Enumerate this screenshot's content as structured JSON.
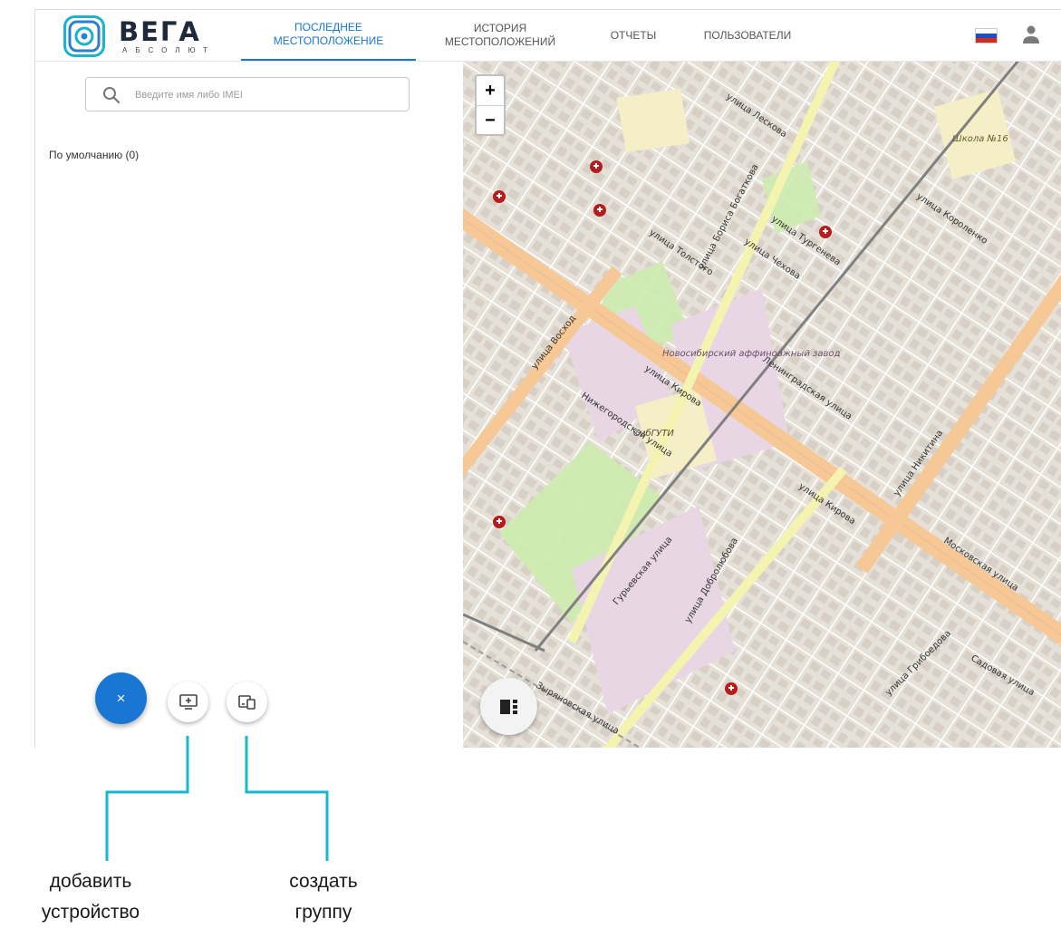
{
  "header": {
    "logo_name": "ВЕГА",
    "logo_sub": "АБСОЛЮТ",
    "tabs": [
      {
        "label_line1": "ПОСЛЕДНЕЕ",
        "label_line2": "МЕСТОПОЛОЖЕНИЕ",
        "active": true
      },
      {
        "label_line1": "ИСТОРИЯ",
        "label_line2": "МЕСТОПОЛОЖЕНИЙ",
        "active": false
      },
      {
        "label_line1": "ОТЧЕТЫ",
        "label_line2": "",
        "active": false
      },
      {
        "label_line1": "ПОЛЬЗОВАТЕЛИ",
        "label_line2": "",
        "active": false
      }
    ],
    "language_flag": "ru-flag-icon",
    "user_icon": "person-icon"
  },
  "sidebar": {
    "search_placeholder": "Введите имя либо IMEI",
    "search_value": "",
    "groups": [
      {
        "label": "По умолчанию (0)"
      }
    ],
    "fab_close_label": "×"
  },
  "map": {
    "zoom_in": "+",
    "zoom_out": "−",
    "labels": [
      {
        "text": "улица Кирова"
      },
      {
        "text": "улица Кирова"
      },
      {
        "text": "улица Восход"
      },
      {
        "text": "улица Бориса Богаткова"
      },
      {
        "text": "Гурьевская улица"
      },
      {
        "text": "Ленинградская улица"
      },
      {
        "text": "Нижегородская улица"
      },
      {
        "text": "улица Никитина"
      },
      {
        "text": "улица Добролюбова"
      },
      {
        "text": "Московская улица"
      },
      {
        "text": "улица Толстого"
      },
      {
        "text": "улица Чехова"
      },
      {
        "text": "улица Тургенева"
      },
      {
        "text": "Новосибирский аффиноажный завод"
      },
      {
        "text": "СибГУТИ"
      },
      {
        "text": "Школа №16"
      },
      {
        "text": "Зыряновская улица"
      },
      {
        "text": "улица Грибоедова"
      },
      {
        "text": "Садовая улица"
      },
      {
        "text": "улица Лескова"
      },
      {
        "text": "улица Короленко"
      }
    ]
  },
  "callouts": {
    "add_device_line1": "добавить",
    "add_device_line2": "устройство",
    "create_group_line1": "создать",
    "create_group_line2": "группу"
  },
  "colors": {
    "accent": "#1976d2",
    "callout_line": "#16b7d6",
    "main_road": "#f6c896",
    "secondary_road": "#f4f3b0",
    "park": "#cdebb0",
    "industrial": "#e9d6e4",
    "rail": "#808080"
  }
}
